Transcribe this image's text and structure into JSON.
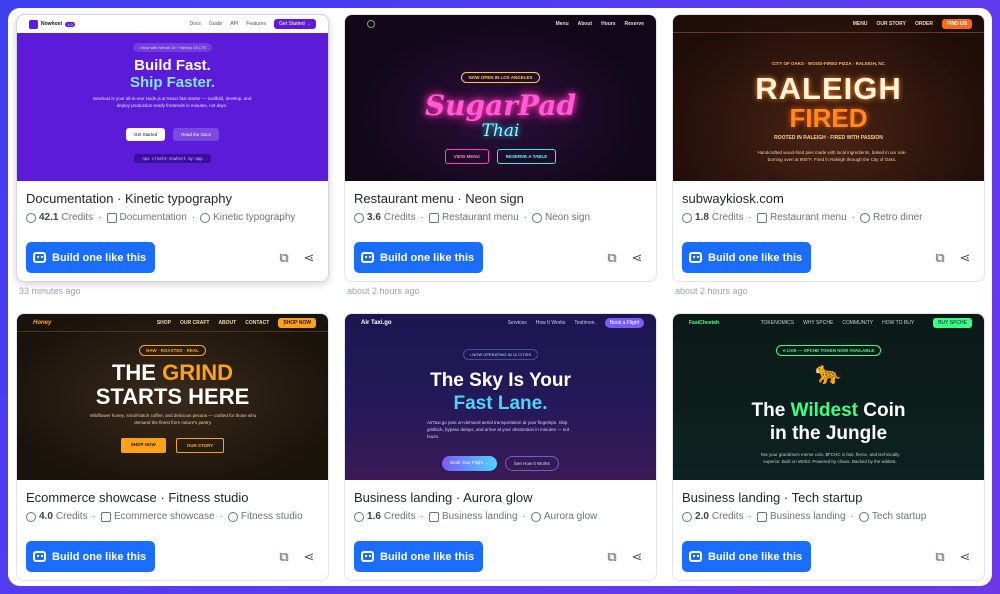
{
  "cards": [
    {
      "title": "Documentation · Kinetic typography",
      "credits": "42.1",
      "credits_suffix": "Credits",
      "tag1": "Documentation",
      "tag2": "Kinetic typography",
      "button": "Build one like this",
      "timestamp": "33 minutes ago",
      "thumb": {
        "brand": "Nowhost",
        "badge": "1.0",
        "nav": [
          "Docs",
          "Guide",
          "API",
          "Features"
        ],
        "cta": "Get Started →",
        "pill": "• Now with Vercel 15 + Next.js 15 LTS",
        "h1": "Build Fast.",
        "h2": "Ship Faster.",
        "desc": "Nowhost is your all-in-one Node.js & React fast starter — scaffold, develop, and deploy production-ready frontends in minutes, not days.",
        "b1": "Get Started",
        "b2": "Read the Docs",
        "code": "npx create-nowhost my-app"
      }
    },
    {
      "title": "Restaurant menu · Neon sign",
      "credits": "3.6",
      "credits_suffix": "Credits",
      "tag1": "Restaurant menu",
      "tag2": "Neon sign",
      "button": "Build one like this",
      "timestamp": "about 2 hours ago",
      "thumb": {
        "nav": [
          "Menu",
          "About",
          "Hours",
          "Reserve"
        ],
        "pill": "NOW OPEN IN LOS ANGELES",
        "h1": "SugarPad",
        "h2": "Thai",
        "b1": "VIEW MENU",
        "b2": "RESERVE A TABLE"
      }
    },
    {
      "title": "subwaykiosk.com",
      "credits": "1.8",
      "credits_suffix": "Credits",
      "tag1": "Restaurant menu",
      "tag2": "Retro diner",
      "button": "Build one like this",
      "timestamp": "about 2 hours ago",
      "thumb": {
        "nav": [
          "MENU",
          "OUR STORY",
          "ORDER"
        ],
        "cta": "FIND US",
        "kicker": "CITY OF OAKS · WOOD-FIRED PIZZA · RALEIGH, NC",
        "h1": "RALEIGH",
        "h2": "FIRED",
        "sub": "ROOTED IN RALEIGH · FIRED WITH PASSION",
        "desc": "Handcrafted wood-fired pies made with local ingredients, baked in our oak-burning oven at 900°F. Fired in Raleigh through the City of Oaks."
      }
    },
    {
      "title": "Ecommerce showcase · Fitness studio",
      "credits": "4.0",
      "credits_suffix": "Credits",
      "tag1": "Ecommerce showcase",
      "tag2": "Fitness studio",
      "button": "Build one like this",
      "thumb": {
        "brand": "Honey",
        "nav": [
          "SHOP",
          "OUR CRAFT",
          "ABOUT",
          "CONTACT"
        ],
        "cta": "SHOP NOW",
        "pill": "RAW · ROASTED · REAL",
        "h1a": "THE",
        "h1b": "GRIND",
        "h2": "STARTS HERE",
        "desc": "Wildflower honey, small-batch coffee, and delicious pecans — crafted for those who demand the finest from nature's pantry.",
        "b1": "SHOP NOW",
        "b2": "OUR STORY"
      }
    },
    {
      "title": "Business landing · Aurora glow",
      "credits": "1.6",
      "credits_suffix": "Credits",
      "tag1": "Business landing",
      "tag2": "Aurora glow",
      "button": "Build one like this",
      "thumb": {
        "brand": "Air Taxi.go",
        "nav": [
          "Services",
          "How It Works",
          "Testimon."
        ],
        "cta": "Book a Flight",
        "pill": "• NOW OPERATING IN 12 CITIES",
        "h1": "The Sky Is Your",
        "h2": "Fast Lane.",
        "desc": "AirTaxi.go puts on-demand aerial transportation at your fingertips. Skip gridlock, bypass delays, and arrive at your destination in minutes — not hours.",
        "b1": "Book Your Flight →",
        "b2": "See How It Works"
      }
    },
    {
      "title": "Business landing · Tech startup",
      "credits": "2.0",
      "credits_suffix": "Credits",
      "tag1": "Business landing",
      "tag2": "Tech startup",
      "button": "Build one like this",
      "thumb": {
        "brand": "FastCheetah",
        "nav": [
          "TOKENOMICS",
          "WHY SPCHE",
          "COMMUNITY",
          "HOW TO BUY"
        ],
        "cta": "BUY SPCHE",
        "pill": "● LIVE — SPCHE TOKEN NOW AVAILABLE",
        "h1a": "The",
        "h1b": "Wildest",
        "h1c": "Coin",
        "h2": "in the Jungle",
        "desc": "Not your grandma's meme coin. $FCHC is fast, fierce, and technically superior. Built on Web3. Powered by chaos. Backed by the wildest."
      }
    }
  ]
}
